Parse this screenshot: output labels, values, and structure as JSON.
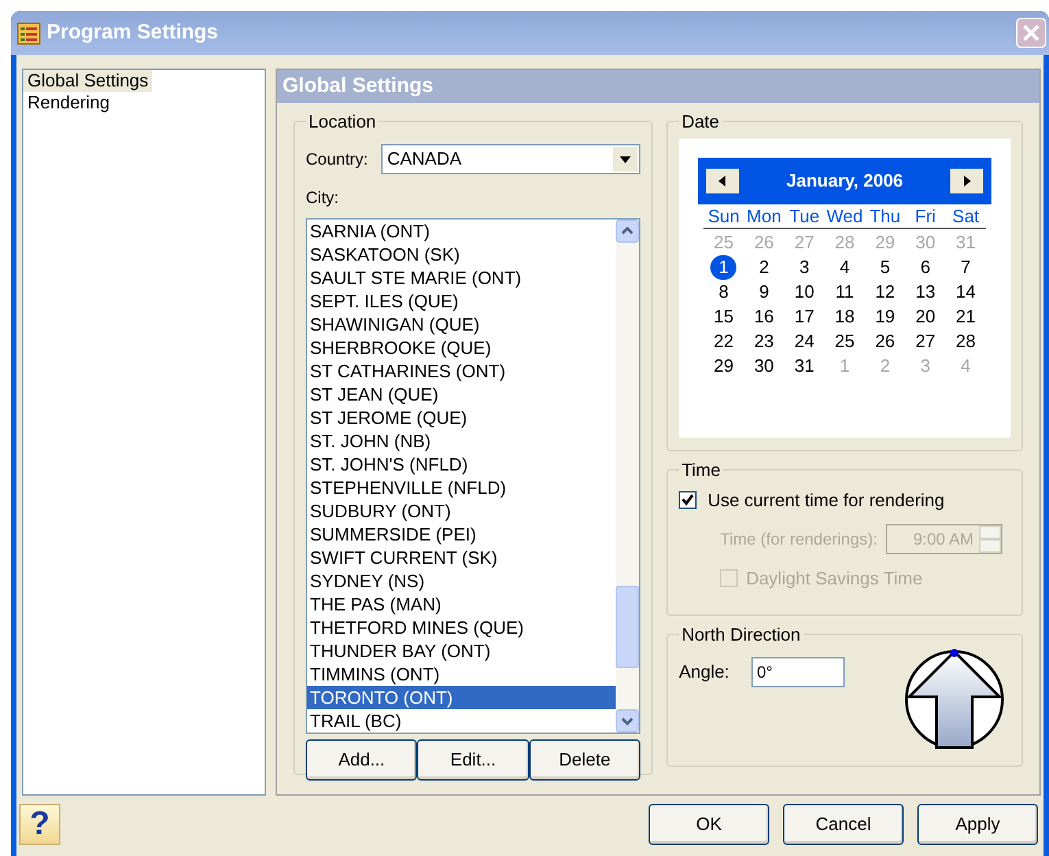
{
  "window": {
    "title": "Program Settings"
  },
  "sidebar": {
    "items": [
      {
        "label": "Global Settings",
        "selected": true
      },
      {
        "label": "Rendering",
        "selected": false
      }
    ]
  },
  "panel": {
    "title": "Global Settings"
  },
  "location": {
    "title": "Location",
    "country_label": "Country:",
    "country": "CANADA",
    "city_label": "City:",
    "cities": [
      {
        "label": "SARNIA (ONT)",
        "selected": false
      },
      {
        "label": "SASKATOON (SK)",
        "selected": false
      },
      {
        "label": "SAULT STE MARIE (ONT)",
        "selected": false
      },
      {
        "label": "SEPT. ILES (QUE)",
        "selected": false
      },
      {
        "label": "SHAWINIGAN (QUE)",
        "selected": false
      },
      {
        "label": "SHERBROOKE (QUE)",
        "selected": false
      },
      {
        "label": "ST CATHARINES (ONT)",
        "selected": false
      },
      {
        "label": "ST JEAN (QUE)",
        "selected": false
      },
      {
        "label": "ST JEROME (QUE)",
        "selected": false
      },
      {
        "label": "ST. JOHN (NB)",
        "selected": false
      },
      {
        "label": "ST. JOHN'S (NFLD)",
        "selected": false
      },
      {
        "label": "STEPHENVILLE (NFLD)",
        "selected": false
      },
      {
        "label": "SUDBURY (ONT)",
        "selected": false
      },
      {
        "label": "SUMMERSIDE (PEI)",
        "selected": false
      },
      {
        "label": "SWIFT CURRENT (SK)",
        "selected": false
      },
      {
        "label": "SYDNEY (NS)",
        "selected": false
      },
      {
        "label": "THE PAS (MAN)",
        "selected": false
      },
      {
        "label": "THETFORD MINES (QUE)",
        "selected": false
      },
      {
        "label": "THUNDER BAY (ONT)",
        "selected": false
      },
      {
        "label": "TIMMINS (ONT)",
        "selected": false
      },
      {
        "label": "TORONTO (ONT)",
        "selected": true
      },
      {
        "label": "TRAIL (BC)",
        "selected": false
      }
    ],
    "buttons": [
      "Add...",
      "Edit...",
      "Delete"
    ]
  },
  "date": {
    "title": "Date",
    "month": "January, 2006",
    "weekdays": [
      "Sun",
      "Mon",
      "Tue",
      "Wed",
      "Thu",
      "Fri",
      "Sat"
    ],
    "days": [
      {
        "label": "25",
        "kind": "other",
        "selected": false
      },
      {
        "label": "26",
        "kind": "other",
        "selected": false
      },
      {
        "label": "27",
        "kind": "other",
        "selected": false
      },
      {
        "label": "28",
        "kind": "other",
        "selected": false
      },
      {
        "label": "29",
        "kind": "other",
        "selected": false
      },
      {
        "label": "30",
        "kind": "other",
        "selected": false
      },
      {
        "label": "31",
        "kind": "other",
        "selected": false
      },
      {
        "label": "1",
        "kind": "current",
        "selected": true
      },
      {
        "label": "2",
        "kind": "current",
        "selected": false
      },
      {
        "label": "3",
        "kind": "current",
        "selected": false
      },
      {
        "label": "4",
        "kind": "current",
        "selected": false
      },
      {
        "label": "5",
        "kind": "current",
        "selected": false
      },
      {
        "label": "6",
        "kind": "current",
        "selected": false
      },
      {
        "label": "7",
        "kind": "current",
        "selected": false
      },
      {
        "label": "8",
        "kind": "current",
        "selected": false
      },
      {
        "label": "9",
        "kind": "current",
        "selected": false
      },
      {
        "label": "10",
        "kind": "current",
        "selected": false
      },
      {
        "label": "11",
        "kind": "current",
        "selected": false
      },
      {
        "label": "12",
        "kind": "current",
        "selected": false
      },
      {
        "label": "13",
        "kind": "current",
        "selected": false
      },
      {
        "label": "14",
        "kind": "current",
        "selected": false
      },
      {
        "label": "15",
        "kind": "current",
        "selected": false
      },
      {
        "label": "16",
        "kind": "current",
        "selected": false
      },
      {
        "label": "17",
        "kind": "current",
        "selected": false
      },
      {
        "label": "18",
        "kind": "current",
        "selected": false
      },
      {
        "label": "19",
        "kind": "current",
        "selected": false
      },
      {
        "label": "20",
        "kind": "current",
        "selected": false
      },
      {
        "label": "21",
        "kind": "current",
        "selected": false
      },
      {
        "label": "22",
        "kind": "current",
        "selected": false
      },
      {
        "label": "23",
        "kind": "current",
        "selected": false
      },
      {
        "label": "24",
        "kind": "current",
        "selected": false
      },
      {
        "label": "25",
        "kind": "current",
        "selected": false
      },
      {
        "label": "26",
        "kind": "current",
        "selected": false
      },
      {
        "label": "27",
        "kind": "current",
        "selected": false
      },
      {
        "label": "28",
        "kind": "current",
        "selected": false
      },
      {
        "label": "29",
        "kind": "current",
        "selected": false
      },
      {
        "label": "30",
        "kind": "current",
        "selected": false
      },
      {
        "label": "31",
        "kind": "current",
        "selected": false
      },
      {
        "label": "1",
        "kind": "other",
        "selected": false
      },
      {
        "label": "2",
        "kind": "other",
        "selected": false
      },
      {
        "label": "3",
        "kind": "other",
        "selected": false
      },
      {
        "label": "4",
        "kind": "other",
        "selected": false
      }
    ]
  },
  "time": {
    "title": "Time",
    "use_current": {
      "label": "Use current time for rendering",
      "checked": true
    },
    "time_label": "Time (for renderings):",
    "time_value": "9:00 AM",
    "disabled": true,
    "daylight": {
      "label": "Daylight Savings Time",
      "checked": false
    }
  },
  "north": {
    "title": "North Direction",
    "angle_label": "Angle:",
    "angle": "0°"
  },
  "help_button": "?",
  "buttons": [
    {
      "label": "OK"
    },
    {
      "label": "Cancel"
    },
    {
      "label": "Apply"
    }
  ]
}
